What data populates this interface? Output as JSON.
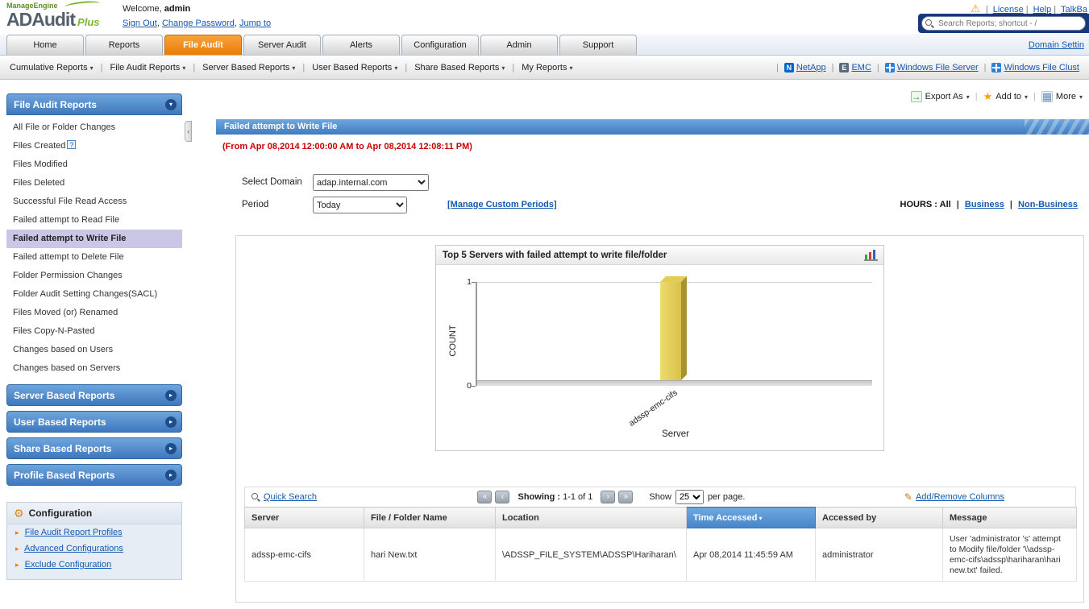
{
  "brand": {
    "company": "ManageEngine",
    "product": "ADAudit",
    "suffix": "Plus"
  },
  "header": {
    "welcome_prefix": "Welcome,",
    "user": "admin",
    "account_links": [
      "Sign Out",
      "Change Password",
      "Jump to"
    ],
    "top_links": [
      "License",
      "Help",
      "TalkBa"
    ],
    "search_placeholder": "Search Reports; shortcut - /"
  },
  "tabs": [
    "Home",
    "Reports",
    "File Audit",
    "Server Audit",
    "Alerts",
    "Configuration",
    "Admin",
    "Support"
  ],
  "active_tab": "File Audit",
  "domain_settings_link": "Domain Settin",
  "subnav": {
    "menus": [
      "Cumulative Reports",
      "File Audit Reports",
      "Server Based Reports",
      "User Based Reports",
      "Share Based Reports",
      "My Reports"
    ],
    "links": [
      "NetApp",
      "EMC",
      "Windows File Server",
      "Windows File Clust"
    ],
    "netapp_icon_letter": "N",
    "emc_icon_letter": "E"
  },
  "sidebar": {
    "section_title": "File Audit Reports",
    "items": [
      "All File or Folder Changes",
      "Files Created",
      "Files Modified",
      "Files Deleted",
      "Successful File Read Access",
      "Failed attempt to Read File",
      "Failed attempt to Write File",
      "Failed attempt to Delete File",
      "Folder Permission Changes",
      "Folder Audit Setting Changes(SACL)",
      "Files Moved (or) Renamed",
      "Files Copy-N-Pasted",
      "Changes based on Users",
      "Changes based on Servers"
    ],
    "selected_item": "Failed attempt to Write File",
    "collapsed_sections": [
      "Server Based Reports",
      "User Based Reports",
      "Share Based Reports",
      "Profile Based Reports"
    ],
    "configuration": {
      "title": "Configuration",
      "links": [
        "File Audit Report Profiles",
        "Advanced Configurations",
        "Exclude Configuration"
      ]
    }
  },
  "toolbar": {
    "export_as": "Export As",
    "add_to": "Add to",
    "more": "More"
  },
  "report": {
    "title": "Failed attempt to Write File",
    "date_range": "(From Apr 08,2014 12:00:00 AM to Apr 08,2014 12:08:11 PM)",
    "filters": {
      "domain_label": "Select Domain",
      "domain_value": "adap.internal.com",
      "period_label": "Period",
      "period_value": "Today",
      "manage_custom_periods": "[Manage Custom Periods]",
      "hours_label": "HOURS :",
      "hours_all": "All",
      "hours_business": "Business",
      "hours_non_business": "Non-Business"
    }
  },
  "chart_data": {
    "type": "bar",
    "title": "Top 5 Servers with failed attempt to write file/folder",
    "categories": [
      "adssp-emc-cifs"
    ],
    "values": [
      1
    ],
    "series": [
      {
        "name": "COUNT",
        "values": [
          1
        ]
      }
    ],
    "xlabel": "Server",
    "ylabel": "COUNT",
    "ylim": [
      0,
      1
    ],
    "yticks": [
      "0",
      "1"
    ],
    "grid": true,
    "legend": false,
    "bar_color": "#E6CF55"
  },
  "table": {
    "quick_search_label": "Quick Search",
    "pagination": {
      "showing_label": "Showing :",
      "range": "1-1 of 1"
    },
    "page_size": {
      "show_label": "Show",
      "value": "25",
      "suffix": "per page."
    },
    "add_remove_columns_label": "Add/Remove Columns",
    "columns": [
      "Server",
      "File / Folder Name",
      "Location",
      "Time Accessed",
      "Accessed by",
      "Message"
    ],
    "sorted_column": "Time Accessed",
    "rows": [
      {
        "server": "adssp-emc-cifs",
        "file_folder_name": "hari New.txt",
        "location": "\\ADSSP_FILE_SYSTEM\\ADSSP\\Hariharan\\",
        "time_accessed": "Apr 08,2014 11:45:59 AM",
        "accessed_by": "administrator",
        "message": "User 'administrator 's' attempt to Modify file/folder '\\\\adssp-emc-cifs\\adssp\\hariharan\\hari new.txt' failed."
      }
    ]
  },
  "colors": {
    "active_tab": "#EE8913",
    "panel_header_blue": "#4584C6",
    "selected_item": "#C9C6E6",
    "alert_red": "#CC0000",
    "link_blue": "#1558B0",
    "bar_yellow": "#E6CF55"
  },
  "icons": {
    "warning-icon": "!",
    "search-icon": "magnifier",
    "chevron-down-icon": "down-triangle",
    "chevron-right-icon": "right-triangle",
    "help-icon": "?",
    "gear-icon": "gear",
    "star-icon": "star",
    "export-icon": "arrow",
    "more-icon": "grid",
    "first-page-icon": "first",
    "prev-page-icon": "prev",
    "next-page-icon": "next",
    "last-page-icon": "last",
    "edit-columns-icon": "pencil",
    "bar-chart-icon": "bars",
    "sort-desc-icon": "down-triangle"
  }
}
